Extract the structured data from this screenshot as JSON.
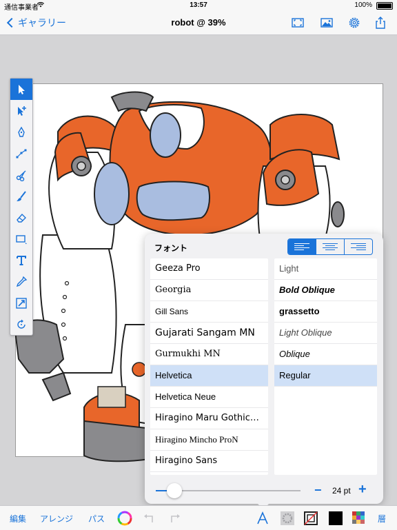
{
  "status": {
    "carrier": "通信事業者",
    "time": "13:57",
    "battery": "100%"
  },
  "nav": {
    "back_label": "ギャラリー",
    "title": "robot @ 39%"
  },
  "popover": {
    "title": "フォント",
    "families": [
      "Geeza Pro",
      "Georgia",
      "Gill Sans",
      "Gujarati Sangam MN",
      "Gurmukhi MN",
      "Helvetica",
      "Helvetica Neue",
      "Hiragino Maru Gothic…",
      "Hiragino Mincho ProN",
      "Hiragino Sans"
    ],
    "selected_family": "Helvetica",
    "styles": [
      "Light",
      "Bold Oblique",
      "grassetto",
      "Light Oblique",
      "Oblique",
      "Regular"
    ],
    "selected_style": "Regular",
    "size_label": "24 pt",
    "slider_fraction": 0.13,
    "minus": "−",
    "plus": "+"
  },
  "bottom": {
    "edit": "編集",
    "arrange": "アレンジ",
    "path": "パス",
    "layers": "層"
  },
  "colors": {
    "accent": "#1a73d9",
    "orange": "#e8662a",
    "blue": "#a9bde0",
    "gray": "#8a8a8d"
  }
}
